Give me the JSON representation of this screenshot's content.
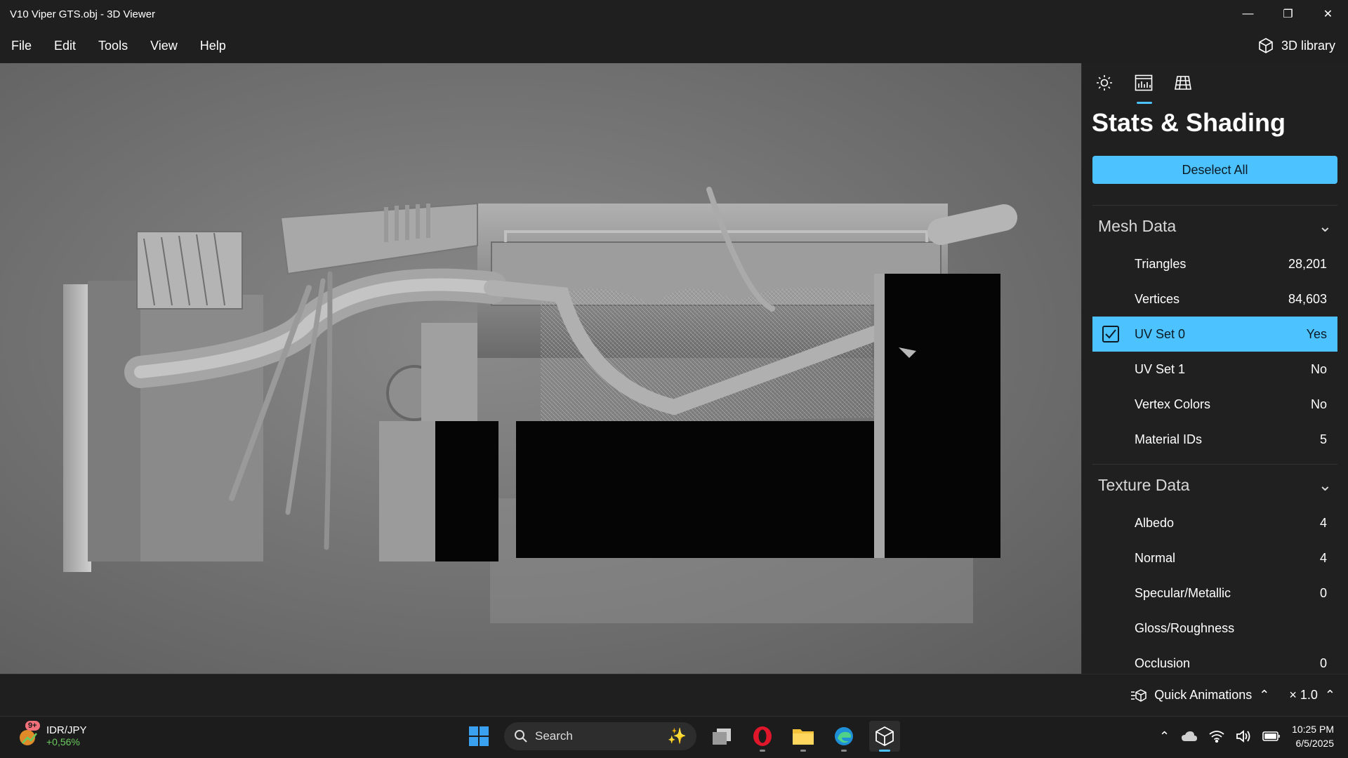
{
  "window": {
    "title": "V10 Viper GTS.obj - 3D Viewer"
  },
  "menu": {
    "items": [
      "File",
      "Edit",
      "Tools",
      "View",
      "Help"
    ],
    "library_label": "3D library"
  },
  "panel": {
    "title": "Stats & Shading",
    "deselect_label": "Deselect All",
    "mesh": {
      "heading": "Mesh Data",
      "rows": [
        {
          "label": "Triangles",
          "value": "28,201"
        },
        {
          "label": "Vertices",
          "value": "84,603"
        },
        {
          "label": "UV Set 0",
          "value": "Yes",
          "selected": true
        },
        {
          "label": "UV Set 1",
          "value": "No"
        },
        {
          "label": "Vertex Colors",
          "value": "No"
        },
        {
          "label": "Material IDs",
          "value": "5"
        }
      ]
    },
    "texture": {
      "heading": "Texture Data",
      "rows": [
        {
          "label": "Albedo",
          "value": "4"
        },
        {
          "label": "Normal",
          "value": "4"
        },
        {
          "label": "Specular/Metallic",
          "value": "0"
        },
        {
          "label": "Gloss/Roughness",
          "value": ""
        },
        {
          "label": "Occlusion",
          "value": "0"
        }
      ]
    }
  },
  "bottom_bar": {
    "quick_animations": "Quick Animations",
    "speed": "× 1.0"
  },
  "taskbar": {
    "ticker_name": "IDR/JPY",
    "ticker_change": "+0,56%",
    "ticker_badge": "9+",
    "search_placeholder": "Search",
    "time": "10:25 PM",
    "date": "6/5/2025"
  },
  "colors": {
    "accent": "#4cc2ff",
    "panel_bg": "#202020",
    "viewport_bg": "#7a7a7a"
  }
}
